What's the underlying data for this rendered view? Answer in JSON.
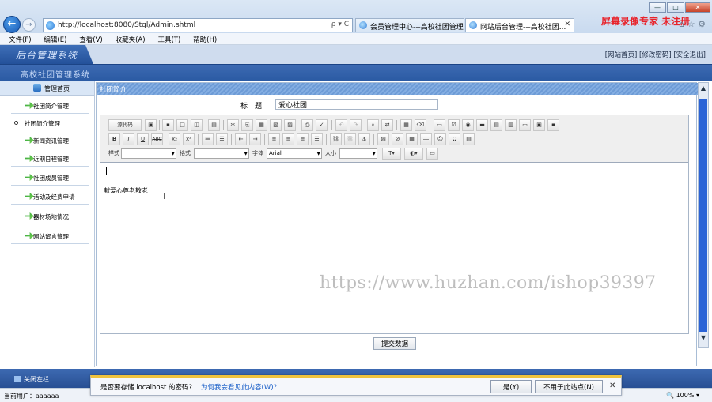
{
  "browser": {
    "url": "http://localhost:8080/Stgl/Admin.shtml",
    "address_tools": "ρ ▾ C",
    "tabs": [
      {
        "label": "会员管理中心---高校社团管理...",
        "close": "✕"
      },
      {
        "label": "网站后台管理---高校社团...",
        "close": "✕"
      }
    ],
    "watermark_brand": "屏幕录像专家 未注册",
    "menu": [
      "文件(F)",
      "编辑(E)",
      "查看(V)",
      "收藏夹(A)",
      "工具(T)",
      "帮助(H)"
    ]
  },
  "header": {
    "app_title": "后台管理系统",
    "links": "[网站首页] [修改密码] [安全退出]",
    "subsystem_title": "高校社团管理系统"
  },
  "sidebar": {
    "header": "管理首页",
    "items": [
      {
        "label": "社团简介管理"
      },
      {
        "label": "社团简介管理"
      },
      {
        "label": "新闻资讯管理"
      },
      {
        "label": "近期日程管理"
      },
      {
        "label": "社团成员管理"
      },
      {
        "label": "活动及经费申请"
      },
      {
        "label": "器材场地情况"
      },
      {
        "label": "网站留言管理"
      }
    ]
  },
  "main": {
    "panel_title": "社团简介",
    "title_label": "标　题:",
    "title_value": "爱心社团",
    "editor": {
      "source_button": "源代码",
      "style_label": "样式",
      "format_label": "格式",
      "font_label": "字体",
      "font_value": "Arial",
      "size_label": "大小",
      "content": "献爱心尊老敬老"
    },
    "submit_label": "提交数据"
  },
  "url_watermark": "https://www.huzhan.com/ishop39397",
  "bottom": {
    "close_sidebar": "关闭左栏",
    "current_user": "当前用户：aaaaaa",
    "zoom": "🔍 100%  ▾"
  },
  "password_prompt": {
    "text": "是否要存储 localhost 的密码?",
    "link": "为何我会看见此内容(W)?",
    "yes": "是(Y)",
    "no": "不用于此站点(N)",
    "close": "✕"
  },
  "colors": {
    "header_blue": "#2a5aa3",
    "scroll_blue": "#2a63d6",
    "brand_red": "#e8232b"
  }
}
